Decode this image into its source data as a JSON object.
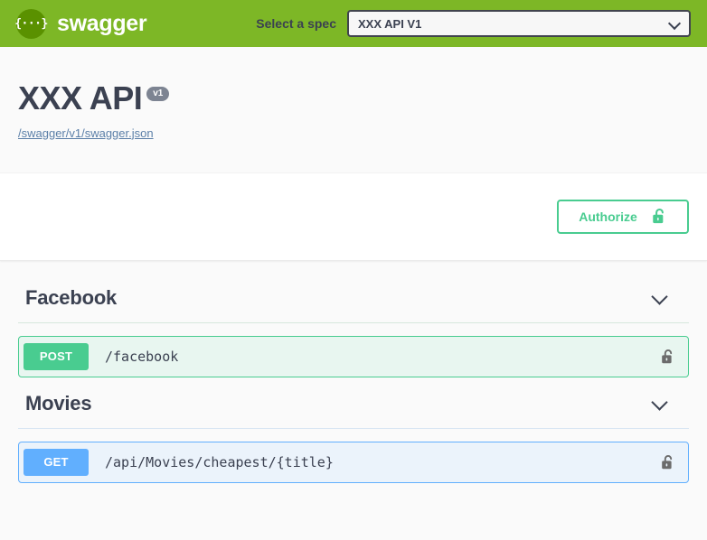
{
  "topbar": {
    "logo_glyph": "{···}",
    "brand": "swagger",
    "spec_label": "Select a spec",
    "selected_spec": "XXX API V1",
    "spec_options": [
      "XXX API V1"
    ],
    "background_color": "#7db726"
  },
  "info": {
    "title": "XXX API",
    "version_badge": "v1",
    "spec_url": "/swagger/v1/swagger.json"
  },
  "auth": {
    "authorize_label": "Authorize",
    "lock_state": "unlocked",
    "accent_color": "#49cc90"
  },
  "sections": [
    {
      "tag": "Facebook",
      "expanded": true,
      "accent_color": "#49cc90",
      "operations": [
        {
          "method": "POST",
          "path": "/facebook",
          "lock_state": "unlocked",
          "method_color": "#49cc90",
          "row_background": "#e8f6f0"
        }
      ]
    },
    {
      "tag": "Movies",
      "expanded": true,
      "accent_color": "#61affe",
      "operations": [
        {
          "method": "GET",
          "path": "/api/Movies/cheapest/{title}",
          "lock_state": "unlocked",
          "method_color": "#61affe",
          "row_background": "#ebf3fb"
        }
      ]
    }
  ]
}
